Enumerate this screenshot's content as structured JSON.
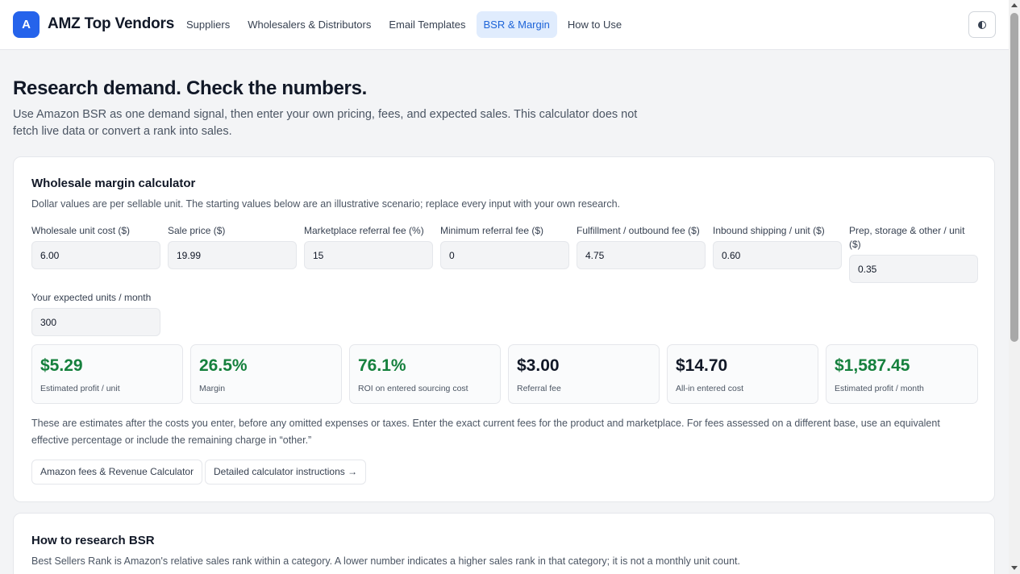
{
  "header": {
    "logo_letter": "A",
    "brand": "AMZ Top Vendors",
    "nav": [
      "Suppliers",
      "Wholesalers & Distributors",
      "Email Templates",
      "BSR & Margin",
      "How to Use"
    ],
    "active_nav": "BSR & Margin"
  },
  "hero": {
    "title": "Research demand. Check the numbers.",
    "subtitle": "Use Amazon BSR as one demand signal, then enter your own pricing, fees, and expected sales. This calculator does not fetch live data or convert a rank into sales."
  },
  "calculator": {
    "title": "Wholesale margin calculator",
    "description": "Dollar values are per sellable unit. The starting values below are an illustrative scenario; replace every input with your own research.",
    "fields": [
      {
        "label": "Wholesale unit cost ($)",
        "value": "6.00"
      },
      {
        "label": "Sale price ($)",
        "value": "19.99"
      },
      {
        "label": "Marketplace referral fee (%)",
        "value": "15"
      },
      {
        "label": "Minimum referral fee ($)",
        "value": "0"
      },
      {
        "label": "Fulfillment / outbound fee ($)",
        "value": "4.75"
      },
      {
        "label": "Inbound shipping / unit ($)",
        "value": "0.60"
      },
      {
        "label": "Prep, storage & other / unit ($)",
        "value": "0.35"
      },
      {
        "label": "Your expected units / month",
        "value": "300"
      }
    ],
    "metrics": [
      {
        "value": "$5.29",
        "label": "Estimated profit / unit",
        "color": "#15803d"
      },
      {
        "value": "26.5%",
        "label": "Margin",
        "color": "#15803d"
      },
      {
        "value": "76.1%",
        "label": "ROI on entered sourcing cost",
        "color": "#15803d"
      },
      {
        "value": "$3.00",
        "label": "Referral fee",
        "color": "#111827"
      },
      {
        "value": "$14.70",
        "label": "All-in entered cost",
        "color": "#111827"
      },
      {
        "value": "$1,587.45",
        "label": "Estimated profit / month",
        "color": "#15803d"
      }
    ],
    "note": "These are estimates after the costs you enter, before any omitted expenses or taxes. Enter the exact current fees for the product and marketplace. For fees assessed on a different base, use an equivalent effective percentage or include the remaining charge in “other.”",
    "buttons": [
      "Amazon fees & Revenue Calculator",
      "Detailed calculator instructions →"
    ]
  },
  "bsr": {
    "title": "How to research BSR",
    "description": "Best Sellers Rank is Amazon's relative sales rank within a category. A lower number indicates a higher sales rank in that category; it is not a monthly unit count."
  }
}
